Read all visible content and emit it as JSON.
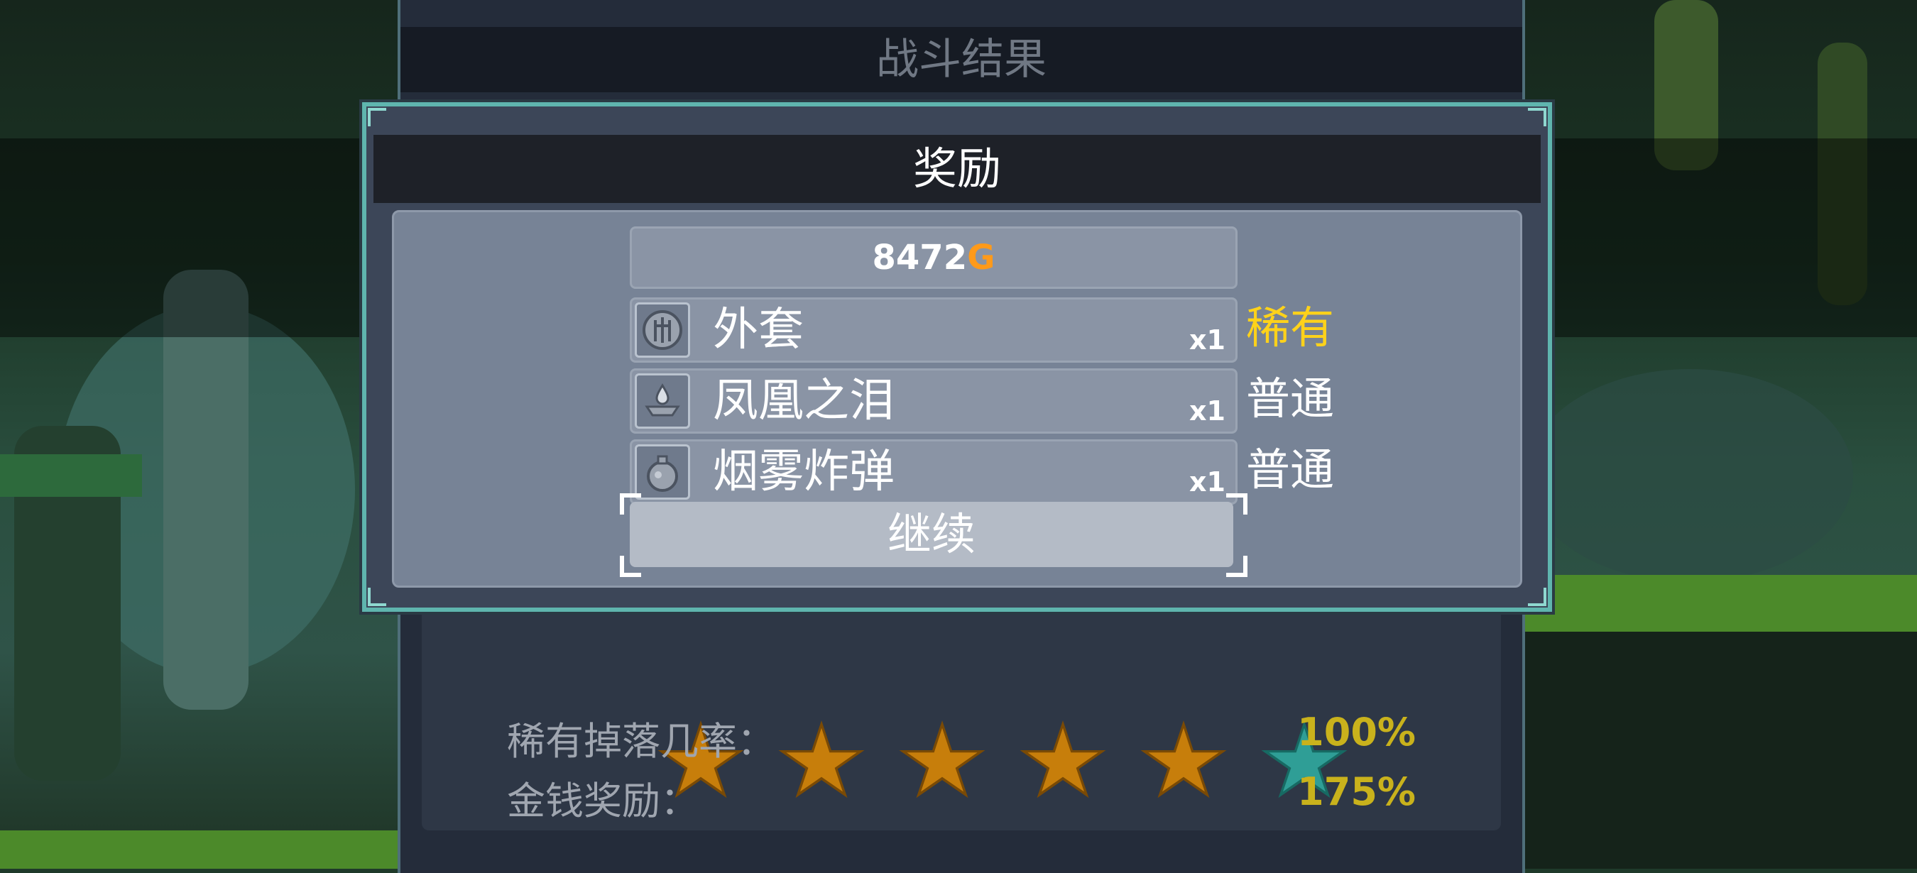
{
  "background_results": {
    "title": "战斗结果",
    "bonus_stats": [
      {
        "label": "稀有掉落几率：",
        "value": "100%"
      },
      {
        "label": "金钱奖励：",
        "value": "175%"
      }
    ],
    "star_rating": {
      "gold_stars": 5,
      "total_stars": 6
    }
  },
  "reward_dialog": {
    "title": "奖励",
    "gold": {
      "amount": "8472",
      "unit": "G"
    },
    "items": [
      {
        "name": "外套",
        "quantity": "x1",
        "rarity": "稀有",
        "rarity_color": "#ffd21a",
        "icon": "coat-icon"
      },
      {
        "name": "凤凰之泪",
        "quantity": "x1",
        "rarity": "普通",
        "rarity_color": "#ffffff",
        "icon": "phoenix-tear-icon"
      },
      {
        "name": "烟雾炸弹",
        "quantity": "x1",
        "rarity": "普通",
        "rarity_color": "#ffffff",
        "icon": "smoke-bomb-icon"
      }
    ],
    "continue_label": "继续"
  },
  "colors": {
    "gold_accent": "#ff9a1a",
    "rare_yellow": "#ffd21a",
    "star_gold": "#c77e0b",
    "star_teal": "#2f9e96",
    "dialog_border": "#5fb5ae"
  }
}
